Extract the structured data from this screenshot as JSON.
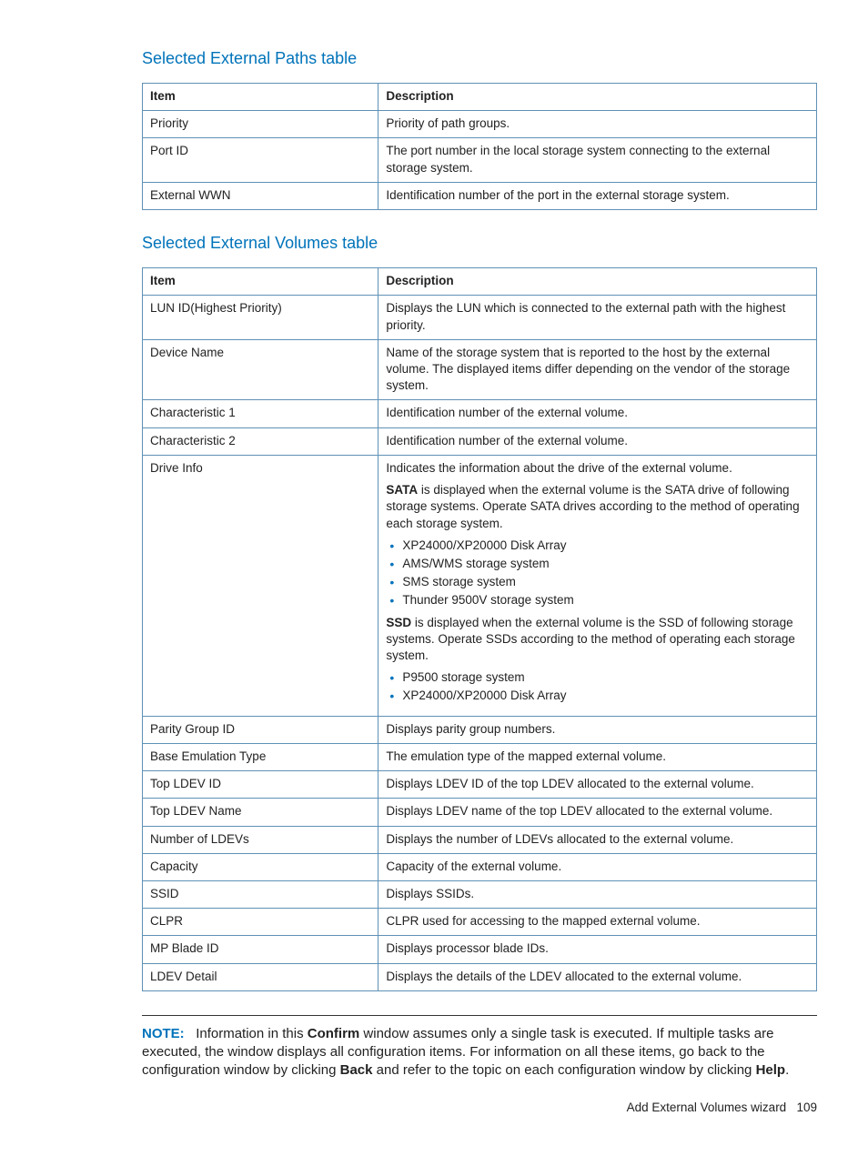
{
  "section1": {
    "title": "Selected External Paths table",
    "header_item": "Item",
    "header_desc": "Description",
    "rows": [
      {
        "item": "Priority",
        "desc": "Priority of path groups."
      },
      {
        "item": "Port ID",
        "desc": "The port number in the local storage system connecting to the external storage system."
      },
      {
        "item": "External WWN",
        "desc": "Identification number of the port in the external storage system."
      }
    ]
  },
  "section2": {
    "title": "Selected External Volumes table",
    "header_item": "Item",
    "header_desc": "Description",
    "rows": {
      "r0": {
        "item": "LUN ID(Highest Priority)",
        "desc": "Displays the LUN which is connected to the external path with the highest priority."
      },
      "r1": {
        "item": "Device Name",
        "desc": "Name of the storage system that is reported to the host by the external volume. The displayed items differ depending on the vendor of the storage system."
      },
      "r2": {
        "item": "Characteristic 1",
        "desc": "Identification number of the external volume."
      },
      "r3": {
        "item": "Characteristic 2",
        "desc": "Identification number of the external volume."
      },
      "r4": {
        "item": "Drive Info",
        "p1": "Indicates the information about the drive of the external volume.",
        "p2a": "SATA",
        "p2b": " is displayed when the external volume is the SATA drive of following storage systems. Operate SATA drives according to the method of operating each storage system.",
        "li1": "XP24000/XP20000 Disk Array",
        "li2": "AMS/WMS storage system",
        "li3": "SMS storage system",
        "li4": "Thunder 9500V storage system",
        "p3a": "SSD",
        "p3b": " is displayed when the external volume is the SSD of following storage systems. Operate SSDs according to the method of operating each storage system.",
        "li5": "P9500 storage system",
        "li6": "XP24000/XP20000 Disk Array"
      },
      "r5": {
        "item": "Parity Group ID",
        "desc": "Displays parity group numbers."
      },
      "r6": {
        "item": "Base Emulation Type",
        "desc": "The emulation type of the mapped external volume."
      },
      "r7": {
        "item": "Top LDEV ID",
        "desc": "Displays LDEV ID of the top LDEV allocated to the external volume."
      },
      "r8": {
        "item": "Top LDEV Name",
        "desc": "Displays LDEV name of the top LDEV allocated to the external volume."
      },
      "r9": {
        "item": "Number of LDEVs",
        "desc": "Displays the number of LDEVs allocated to the external volume."
      },
      "r10": {
        "item": "Capacity",
        "desc": "Capacity of the external volume."
      },
      "r11": {
        "item": "SSID",
        "desc": "Displays SSIDs."
      },
      "r12": {
        "item": "CLPR",
        "desc": "CLPR used for accessing to the mapped external volume."
      },
      "r13": {
        "item": "MP Blade ID",
        "desc": "Displays processor blade IDs."
      },
      "r14": {
        "item": "LDEV Detail",
        "desc": "Displays the details of the LDEV allocated to the external volume."
      }
    }
  },
  "note": {
    "label": "NOTE:",
    "t1": "Information in this ",
    "b1": "Confirm",
    "t2": " window assumes only a single task is executed. If multiple tasks are executed, the window displays all configuration items. For information on all these items, go back to the configuration window by clicking ",
    "b2": "Back",
    "t3": " and refer to the topic on each configuration window by clicking ",
    "b3": "Help",
    "t4": "."
  },
  "footer": {
    "text": "Add External Volumes wizard",
    "page": "109"
  }
}
